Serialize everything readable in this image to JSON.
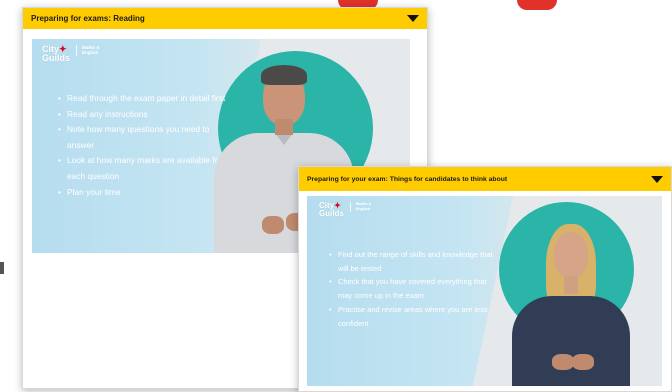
{
  "panels": [
    {
      "title": "Preparing for exams: Reading",
      "logo": {
        "line1": "City",
        "line2": "Guilds",
        "sub1": "Maths &",
        "sub2": "English"
      },
      "bullets": [
        "Read through the exam paper in detail first",
        "Read any instructions",
        "Note how many questions you need to answer",
        "Look at how many marks are available for each question",
        "Plan your time"
      ]
    },
    {
      "title": "Preparing for your exam: Things for candidates to think about",
      "logo": {
        "line1": "City",
        "line2": "Guilds",
        "sub1": "Maths &",
        "sub2": "English"
      },
      "bullets": [
        "Find out the range of skills and knowledge that will be tested",
        "Check that you have covered everything that may come up in the exam",
        "Practise and revise areas where you are less confident"
      ]
    }
  ],
  "icons": {
    "header_toggle": "chevron-down-icon",
    "logo_mark": "city-guilds-star-icon"
  },
  "colors": {
    "header": "#ffcc00",
    "teal": "#2bb4a8",
    "slide_blue": "#b5ddef",
    "brand_red": "#e3001b"
  }
}
